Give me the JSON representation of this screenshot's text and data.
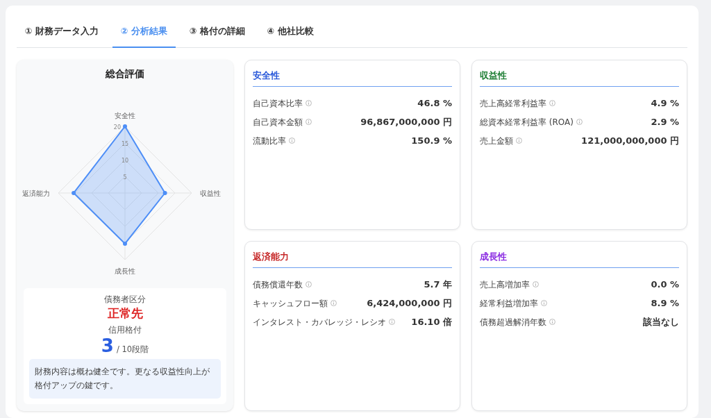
{
  "tabs": [
    {
      "label": "① 財務データ入力",
      "selected": false
    },
    {
      "label": "② 分析結果",
      "selected": true
    },
    {
      "label": "③ 格付の詳細",
      "selected": false
    },
    {
      "label": "④ 他社比較",
      "selected": false
    }
  ],
  "overall": {
    "title": "総合評価",
    "radar": {
      "axes": [
        "安全性",
        "収益性",
        "成長性",
        "返済能力"
      ],
      "ticks": [
        "20",
        "15",
        "10",
        "5"
      ]
    },
    "summary": {
      "category_label": "債務者区分",
      "category_value": "正常先",
      "rating_label": "信用格付",
      "rating_value": "3",
      "rating_scale": "/ 10段階",
      "note": "財務内容は概ね健全です。更なる収益性向上が格付アップの鍵です。"
    }
  },
  "metric_cards": [
    {
      "title": "安全性",
      "color": "#2656d9",
      "rows": [
        {
          "label": "自己資本比率",
          "value": "46.8 %"
        },
        {
          "label": "自己資本金額",
          "value": "96,867,000,000 円"
        },
        {
          "label": "流動比率",
          "value": "150.9 %"
        }
      ]
    },
    {
      "title": "収益性",
      "color": "#1e7e34",
      "rows": [
        {
          "label": "売上高経常利益率",
          "value": "4.9 %"
        },
        {
          "label": "総資本経常利益率 (ROA)",
          "value": "2.9 %"
        },
        {
          "label": "売上金額",
          "value": "121,000,000,000 円"
        }
      ]
    },
    {
      "title": "返済能力",
      "color": "#c62828",
      "rows": [
        {
          "label": "債務償還年数",
          "value": "5.7 年"
        },
        {
          "label": "キャッシュフロー額",
          "value": "6,424,000,000 円"
        },
        {
          "label": "インタレスト・カバレッジ・レシオ",
          "value": "16.10 倍"
        }
      ]
    },
    {
      "title": "成長性",
      "color": "#8a2be2",
      "rows": [
        {
          "label": "売上高増加率",
          "value": "0.0 %"
        },
        {
          "label": "経常利益増加率",
          "value": "8.9 %"
        },
        {
          "label": "債務超過解消年数",
          "value": "該当なし"
        }
      ]
    }
  ]
}
